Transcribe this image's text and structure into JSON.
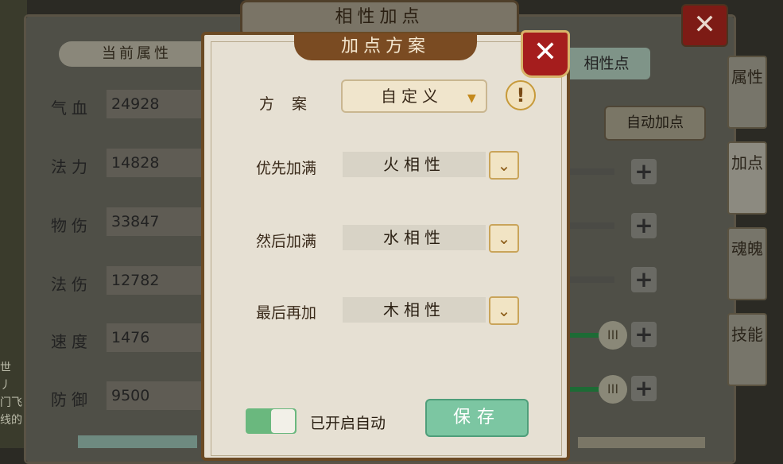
{
  "window": {
    "title": "相性加点"
  },
  "left_panel": {
    "tab_label": "当前属性",
    "stats": [
      {
        "label": "气血",
        "value": "24928"
      },
      {
        "label": "法力",
        "value": "14828"
      },
      {
        "label": "物伤",
        "value": "33847"
      },
      {
        "label": "法伤",
        "value": "12782"
      },
      {
        "label": "速度",
        "value": "1476"
      },
      {
        "label": "防御",
        "value": "9500"
      }
    ]
  },
  "right_panel": {
    "attr_points_label": "相性点",
    "auto_add_label": "自动加点"
  },
  "side_tabs": [
    "属性",
    "加点",
    "魂魄",
    "技能"
  ],
  "left_edge_text": "世\n丿\n门飞\n线的",
  "dialog": {
    "title": "加点方案",
    "scheme_label": "方  案",
    "scheme_value": "自定义",
    "info_icon": "!",
    "rows": [
      {
        "label": "优先加满",
        "value": "火相性"
      },
      {
        "label": "然后加满",
        "value": "水相性"
      },
      {
        "label": "最后再加",
        "value": "木相性"
      }
    ],
    "auto_on_label": "已开启自动",
    "save_label": "保存"
  },
  "colors": {
    "accent_brown": "#7a4b22",
    "save_green": "#7cc6a2",
    "toggle_green": "#6ab87e",
    "close_red": "#a51d1d"
  }
}
